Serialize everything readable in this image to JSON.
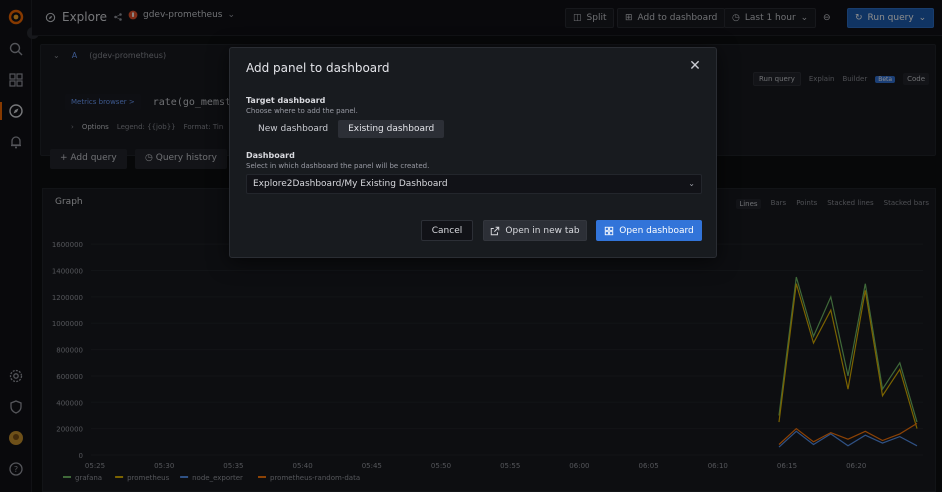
{
  "topnav": {
    "title": "Explore",
    "datasource": "gdev-prometheus",
    "split_label": "Split",
    "add_to_dashboard_label": "Add to dashboard",
    "time_range_label": "Last 1 hour",
    "run_query_label": "Run query"
  },
  "query_row": {
    "letter": "A",
    "datasource": "(gdev-prometheus)",
    "metrics_browser_label": "Metrics browser >",
    "query_text": "rate(go_memsta",
    "options_label": "Options",
    "legend_label": "Legend: {{job}}",
    "format_label": "Format: Tin",
    "run_queries_label": "Run query",
    "explain_label": "Explain",
    "builder_label": "Builder",
    "beta_label": "Beta",
    "code_label": "Code"
  },
  "actions": {
    "add_query_label": "Add query",
    "query_history_label": "Query history"
  },
  "graph": {
    "title": "Graph",
    "modes": [
      "Lines",
      "Bars",
      "Points",
      "Stacked lines",
      "Stacked bars"
    ],
    "active_mode": "Lines"
  },
  "chart_data": {
    "type": "line",
    "title": "Graph",
    "xlabel": "",
    "ylabel": "",
    "x": [
      "05:25",
      "05:30",
      "05:35",
      "05:40",
      "05:45",
      "05:50",
      "05:55",
      "06:00",
      "06:05",
      "06:10",
      "06:15",
      "06:20"
    ],
    "y_ticks": [
      "0",
      "200000",
      "400000",
      "600000",
      "800000",
      "1000000",
      "1200000",
      "1400000",
      "1600000"
    ],
    "ylim": [
      0,
      1700000
    ],
    "legend_position": "bottom-left",
    "series": [
      {
        "name": "grafana",
        "color": "#73bf69",
        "values": [
          null,
          null,
          null,
          null,
          null,
          null,
          null,
          null,
          null,
          null,
          300000,
          1350000,
          900000,
          1200000,
          600000,
          1300000,
          500000,
          700000,
          250000
        ]
      },
      {
        "name": "prometheus",
        "color": "#e0b400",
        "values": [
          null,
          null,
          null,
          null,
          null,
          null,
          null,
          null,
          null,
          null,
          250000,
          1300000,
          850000,
          1100000,
          500000,
          1250000,
          450000,
          650000,
          200000
        ]
      },
      {
        "name": "node_exporter",
        "color": "#5794f2",
        "values": [
          null,
          null,
          null,
          null,
          null,
          null,
          null,
          null,
          null,
          null,
          60000,
          180000,
          80000,
          160000,
          70000,
          150000,
          90000,
          140000,
          70000
        ]
      },
      {
        "name": "prometheus-random-data",
        "color": "#ff780a",
        "values": [
          null,
          null,
          null,
          null,
          null,
          null,
          null,
          null,
          null,
          null,
          80000,
          200000,
          100000,
          170000,
          120000,
          180000,
          110000,
          160000,
          240000
        ]
      }
    ]
  },
  "modal": {
    "title": "Add panel to dashboard",
    "target_label": "Target dashboard",
    "target_desc": "Choose where to add the panel.",
    "opt_new": "New dashboard",
    "opt_existing": "Existing dashboard",
    "dashboard_label": "Dashboard",
    "dashboard_desc": "Select in which dashboard the panel will be created.",
    "dashboard_value": "Explore2Dashboard/My Existing Dashboard",
    "cancel_label": "Cancel",
    "open_new_tab_label": "Open in new tab",
    "open_dashboard_label": "Open dashboard"
  }
}
